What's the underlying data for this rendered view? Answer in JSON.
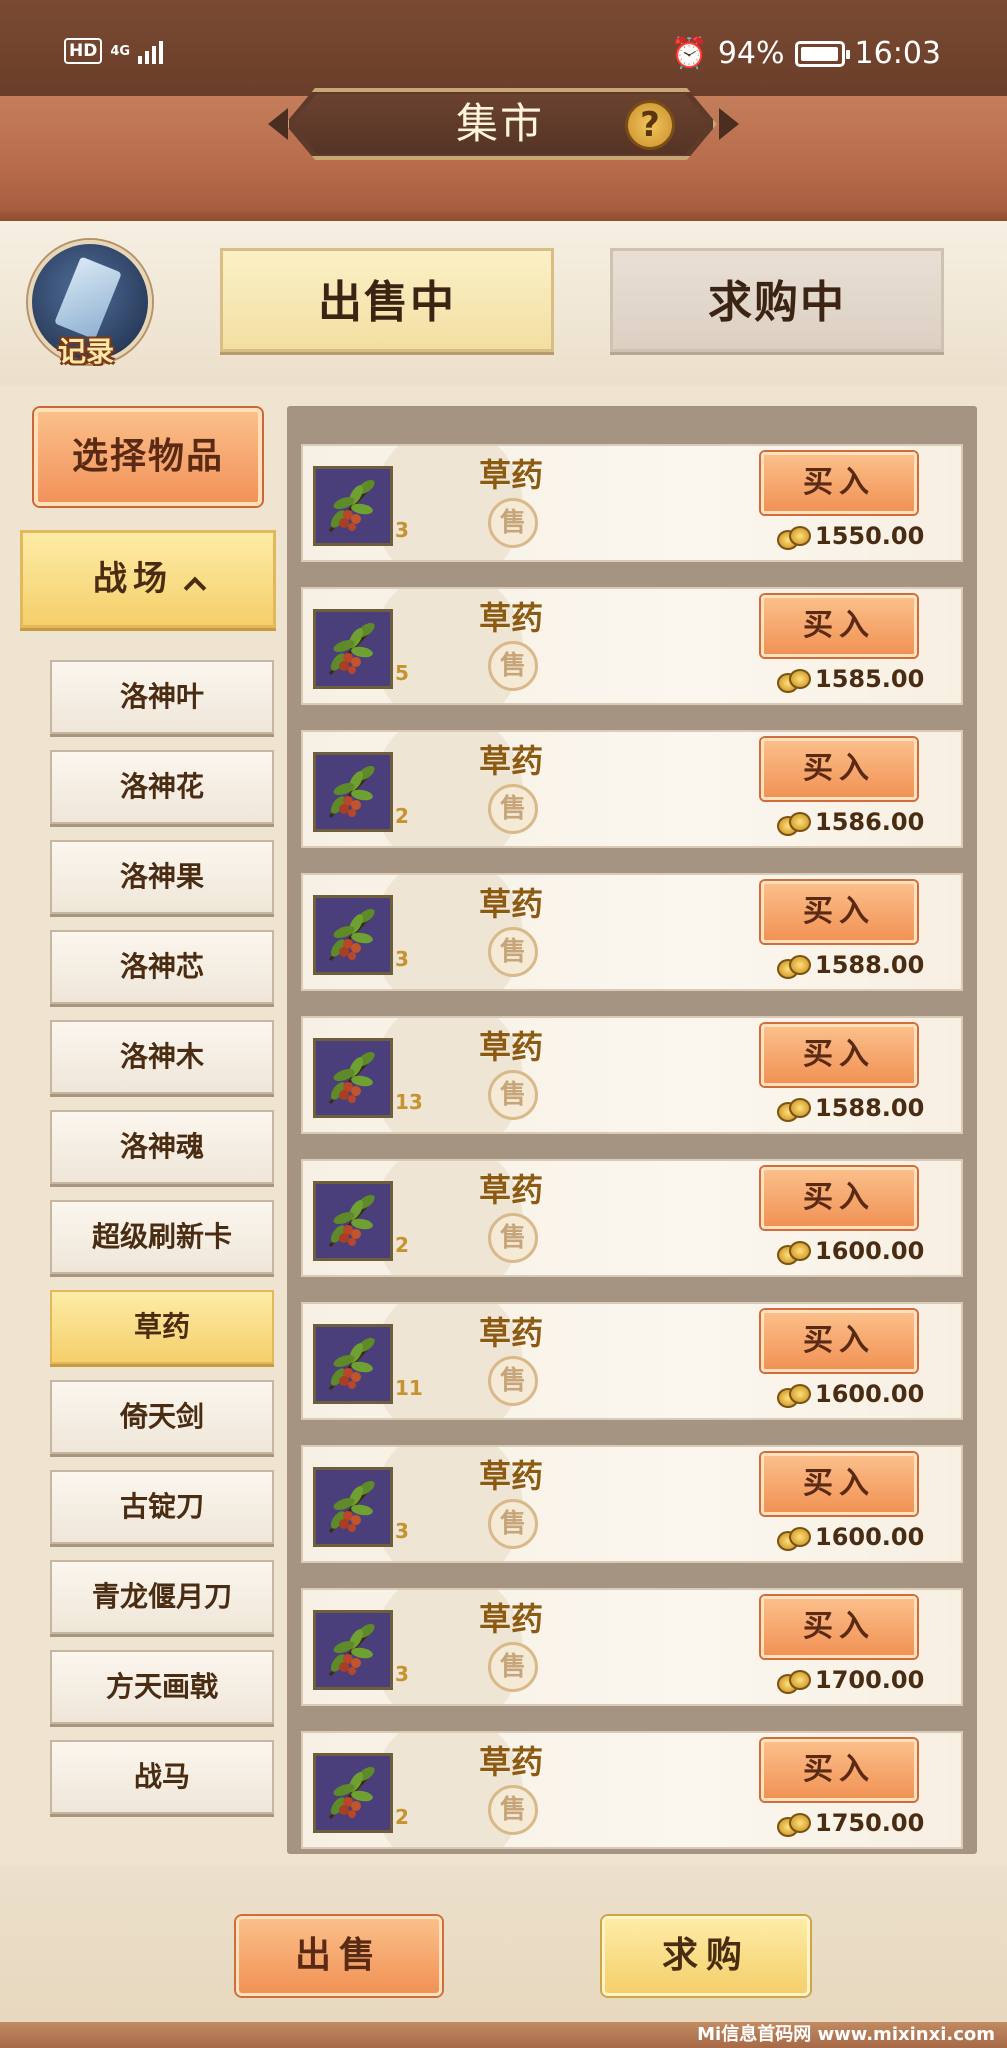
{
  "status_bar": {
    "hd": "HD",
    "network": "4G",
    "battery": "94%",
    "time": "16:03"
  },
  "header": {
    "title": "集市",
    "help": "?"
  },
  "record": {
    "label": "记录"
  },
  "tabs": [
    {
      "label": "出售中",
      "selected": true
    },
    {
      "label": "求购中",
      "selected": false
    }
  ],
  "sidebar": {
    "select_label": "选择物品",
    "category_label": "战场",
    "items": [
      {
        "label": "洛神叶"
      },
      {
        "label": "洛神花"
      },
      {
        "label": "洛神果"
      },
      {
        "label": "洛神芯"
      },
      {
        "label": "洛神木"
      },
      {
        "label": "洛神魂"
      },
      {
        "label": "超级刷新卡"
      },
      {
        "label": "草药",
        "active": true
      },
      {
        "label": "倚天剑"
      },
      {
        "label": "古锭刀"
      },
      {
        "label": "青龙偃月刀"
      },
      {
        "label": "方天画戟"
      },
      {
        "label": "战马"
      }
    ]
  },
  "listings": [
    {
      "name": "草药",
      "qty": "3",
      "seal": "售",
      "buy_label": "买入",
      "price": "1550.00"
    },
    {
      "name": "草药",
      "qty": "5",
      "seal": "售",
      "buy_label": "买入",
      "price": "1585.00"
    },
    {
      "name": "草药",
      "qty": "2",
      "seal": "售",
      "buy_label": "买入",
      "price": "1586.00"
    },
    {
      "name": "草药",
      "qty": "3",
      "seal": "售",
      "buy_label": "买入",
      "price": "1588.00"
    },
    {
      "name": "草药",
      "qty": "13",
      "seal": "售",
      "buy_label": "买入",
      "price": "1588.00"
    },
    {
      "name": "草药",
      "qty": "2",
      "seal": "售",
      "buy_label": "买入",
      "price": "1600.00"
    },
    {
      "name": "草药",
      "qty": "11",
      "seal": "售",
      "buy_label": "买入",
      "price": "1600.00"
    },
    {
      "name": "草药",
      "qty": "3",
      "seal": "售",
      "buy_label": "买入",
      "price": "1600.00"
    },
    {
      "name": "草药",
      "qty": "3",
      "seal": "售",
      "buy_label": "买入",
      "price": "1700.00"
    },
    {
      "name": "草药",
      "qty": "2",
      "seal": "售",
      "buy_label": "买入",
      "price": "1750.00"
    }
  ],
  "bottom": {
    "sell_label": "出售",
    "request_label": "求购"
  },
  "watermark": "Mi信息首码网 www.mixinxi.com",
  "colors": {
    "accent_orange": "#f19255",
    "accent_yellow": "#f5cf6b",
    "header_brown": "#b86c4b",
    "panel": "#a59481"
  }
}
